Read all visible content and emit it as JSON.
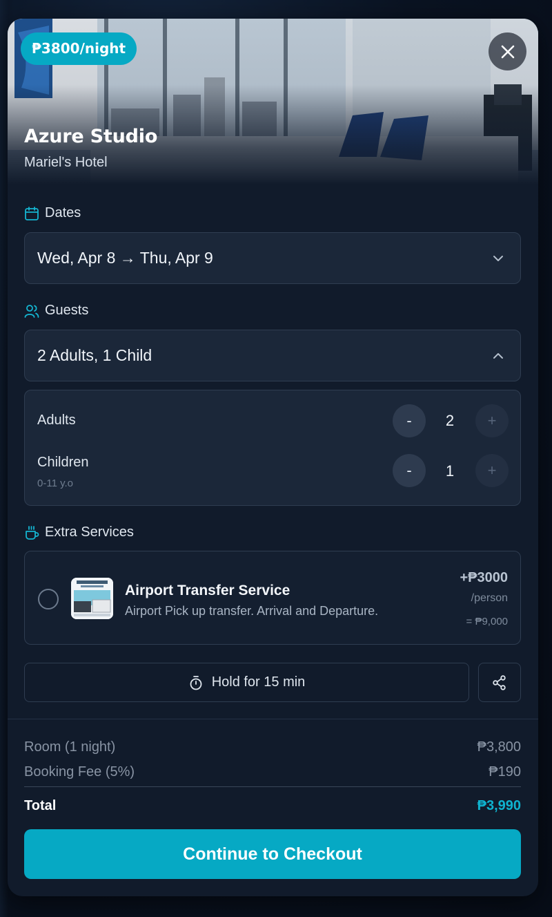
{
  "hero": {
    "price_badge": "₱3800/night",
    "title": "Azure Studio",
    "subtitle": "Mariel's Hotel"
  },
  "dates": {
    "label": "Dates",
    "value": "Wed, Apr 8 → Thu, Apr 9"
  },
  "guests": {
    "label": "Guests",
    "summary": "2 Adults, 1 Child",
    "adults": {
      "label": "Adults",
      "count": "2",
      "minus": "-",
      "plus": "+"
    },
    "children": {
      "label": "Children",
      "hint": "0-11 y.o",
      "count": "1",
      "minus": "-",
      "plus": "+"
    }
  },
  "extras": {
    "label": "Extra Services",
    "service": {
      "name": "Airport Transfer Service",
      "description": "Airport Pick up transfer. Arrival and Departure.",
      "price": "+₱3000",
      "unit": "/person",
      "total": "= ₱9,000"
    }
  },
  "actions": {
    "hold_label": "Hold for 15 min"
  },
  "summary": {
    "room_label": "Room (1 night)",
    "room_amount": "₱3,800",
    "fee_label": "Booking Fee (5%)",
    "fee_amount": "₱190",
    "total_label": "Total",
    "total_amount": "₱3,990"
  },
  "checkout_label": "Continue to Checkout",
  "colors": {
    "accent": "#06a9c4",
    "card_bg": "#111b2b",
    "field_bg": "#1b2739"
  },
  "icons": [
    "close-icon",
    "calendar-icon",
    "users-icon",
    "chevron-down-icon",
    "chevron-up-icon",
    "coffee-cup-icon",
    "stopwatch-icon",
    "share-icon"
  ]
}
